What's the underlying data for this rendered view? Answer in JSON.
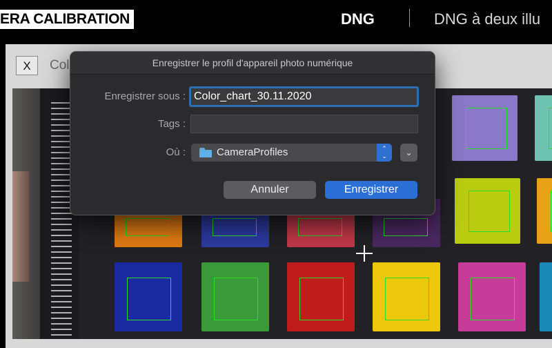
{
  "header": {
    "brand": "ERA CALIBRATION",
    "nav_item_1": "DNG",
    "nav_item_2": "DNG à deux illu"
  },
  "app_window": {
    "close_label": "X",
    "title": "Col"
  },
  "dialog": {
    "title": "Enregistrer le profil d'appareil photo numérique",
    "save_as_label": "Enregistrer sous :",
    "save_as_value": "Color_chart_30.11.2020",
    "tags_label": "Tags :",
    "tags_value": "",
    "where_label": "Où :",
    "where_value": "CameraProfiles",
    "where_icon": "folder-icon",
    "stepper_up": "⌃",
    "stepper_down": "⌄",
    "expand_icon": "chevron-down-icon",
    "expand_glyph": "⌄",
    "cancel_label": "Annuler",
    "save_label": "Enregistrer",
    "accent_color": "#2b6fd6"
  },
  "color_chart": {
    "selection_color": "#2bdc2b",
    "patches": [
      {
        "name": "purple",
        "color": "#8a78c8"
      },
      {
        "name": "teal",
        "color": "#6ec2b0"
      },
      {
        "name": "yellow-green",
        "color": "#b9cc10"
      },
      {
        "name": "orange-yellow",
        "color": "#e8a216"
      },
      {
        "name": "orange",
        "color": "#dd7a12"
      },
      {
        "name": "blue",
        "color": "#2d3aa0"
      },
      {
        "name": "red-pink",
        "color": "#c0384a"
      },
      {
        "name": "purple-dark",
        "color": "#4a2860"
      },
      {
        "name": "blue-dark",
        "color": "#1a2aa0"
      },
      {
        "name": "green",
        "color": "#3a9a3a"
      },
      {
        "name": "red",
        "color": "#c01c1c"
      },
      {
        "name": "yellow",
        "color": "#ecc80c"
      },
      {
        "name": "magenta",
        "color": "#c63c98"
      },
      {
        "name": "cyan",
        "color": "#1c8ab8"
      }
    ]
  }
}
